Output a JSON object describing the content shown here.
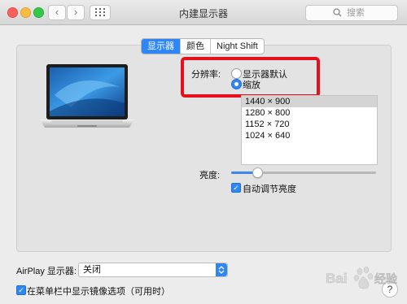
{
  "window": {
    "title": "内建显示器",
    "back_icon": "‹",
    "forward_icon": "›",
    "search_placeholder": "搜索"
  },
  "tabs": [
    {
      "label": "显示器",
      "active": true
    },
    {
      "label": "颜色",
      "active": false
    },
    {
      "label": "Night Shift",
      "active": false
    }
  ],
  "resolution": {
    "label": "分辨率:",
    "options": [
      {
        "label": "显示器默认",
        "selected": false
      },
      {
        "label": "缩放",
        "selected": true
      }
    ],
    "scaled_list": [
      "1440 × 900",
      "1280 × 800",
      "1152 × 720",
      "1024 × 640"
    ],
    "selected_index": 0
  },
  "brightness": {
    "label": "亮度:",
    "level": 0.18,
    "auto_label": "自动调节亮度",
    "auto_checked": true
  },
  "airplay": {
    "label": "AirPlay 显示器:",
    "value": "关闭"
  },
  "menubar_mirroring": {
    "label": "在菜单栏中显示镜像选项（可用时）",
    "checked": true
  },
  "help_label": "?",
  "watermark_text": "Bai 经验",
  "colors": {
    "accent": "#2f87f7",
    "highlight_box": "#e5101c"
  }
}
